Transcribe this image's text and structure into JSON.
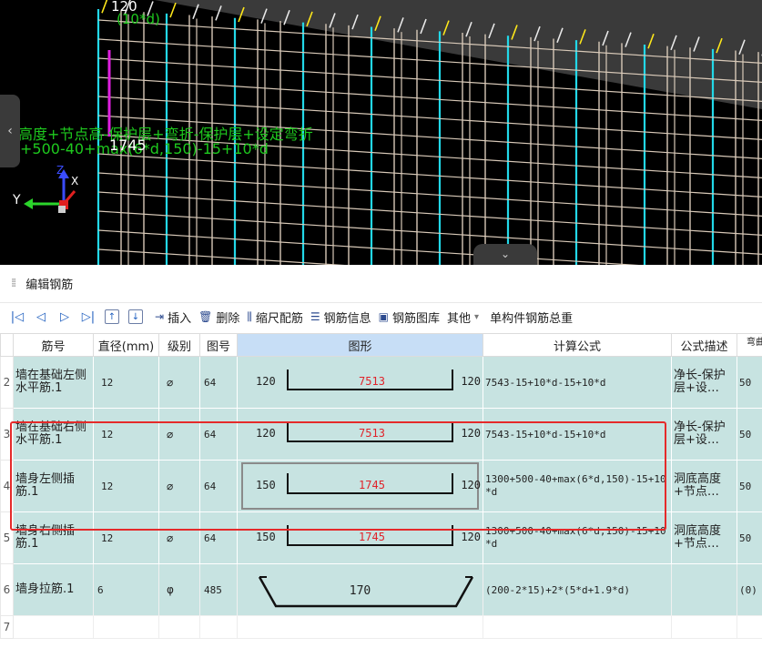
{
  "viewport": {
    "top_label": "120",
    "top_label2": "(10*d)",
    "formula_line1": "高度+节点高-保护层+弯折-保护层+设定弯折",
    "formula_line2": "+500-40+max(6*d,150)-15+10*d",
    "dimension": "1745",
    "axis_x": "X",
    "axis_y": "Y",
    "axis_z": "Z",
    "left_handle": "‹",
    "bottom_handle": "⌄"
  },
  "panel": {
    "title": "编辑钢筋",
    "toolbar": {
      "first": "|◁",
      "prev": "◁",
      "next": "▷",
      "last": "▷|",
      "move_up": "↑",
      "move_down": "↓",
      "insert": "插入",
      "delete": "删除",
      "scale_rebar": "缩尺配筋",
      "rebar_info": "钢筋信息",
      "rebar_library": "钢筋图库",
      "other": "其他",
      "total": "单构件钢筋总重"
    },
    "columns": [
      "筋号",
      "直径(mm)",
      "级别",
      "图号",
      "图形",
      "计算公式",
      "公式描述",
      "弯曲"
    ],
    "rows": [
      {
        "num": "2",
        "name": "墙在基础左侧水平筋.1",
        "dia": "12",
        "grade": "⌀",
        "fig_no": "64",
        "left": "120",
        "mid": "7513",
        "right": "120",
        "formula": "7543-15+10*d-15+10*d",
        "desc": "净长-保护层+设…",
        "bend": "50"
      },
      {
        "num": "3",
        "name": "墙在基础右侧水平筋.1",
        "dia": "12",
        "grade": "⌀",
        "fig_no": "64",
        "left": "120",
        "mid": "7513",
        "right": "120",
        "formula": "7543-15+10*d-15+10*d",
        "desc": "净长-保护层+设…",
        "bend": "50"
      },
      {
        "num": "4",
        "name": "墙身左侧插筋.1",
        "dia": "12",
        "grade": "⌀",
        "fig_no": "64",
        "left": "150",
        "mid": "1745",
        "right": "120",
        "formula": "1300+500-40+max(6*d,150)-15+10*d",
        "desc": "洞底高度+节点…",
        "bend": "50"
      },
      {
        "num": "5",
        "name": "墙身右侧插筋.1",
        "dia": "12",
        "grade": "⌀",
        "fig_no": "64",
        "left": "150",
        "mid": "1745",
        "right": "120",
        "formula": "1300+500-40+max(6*d,150)-15+10*d",
        "desc": "洞底高度+节点…",
        "bend": "50"
      },
      {
        "num": "6",
        "name": "墙身拉筋.1",
        "dia": "6",
        "grade": "φ",
        "fig_no": "485",
        "mid": "170",
        "formula": "(200-2*15)+2*(5*d+1.9*d)",
        "desc": "",
        "bend": "(0)"
      },
      {
        "num": "7"
      }
    ]
  }
}
